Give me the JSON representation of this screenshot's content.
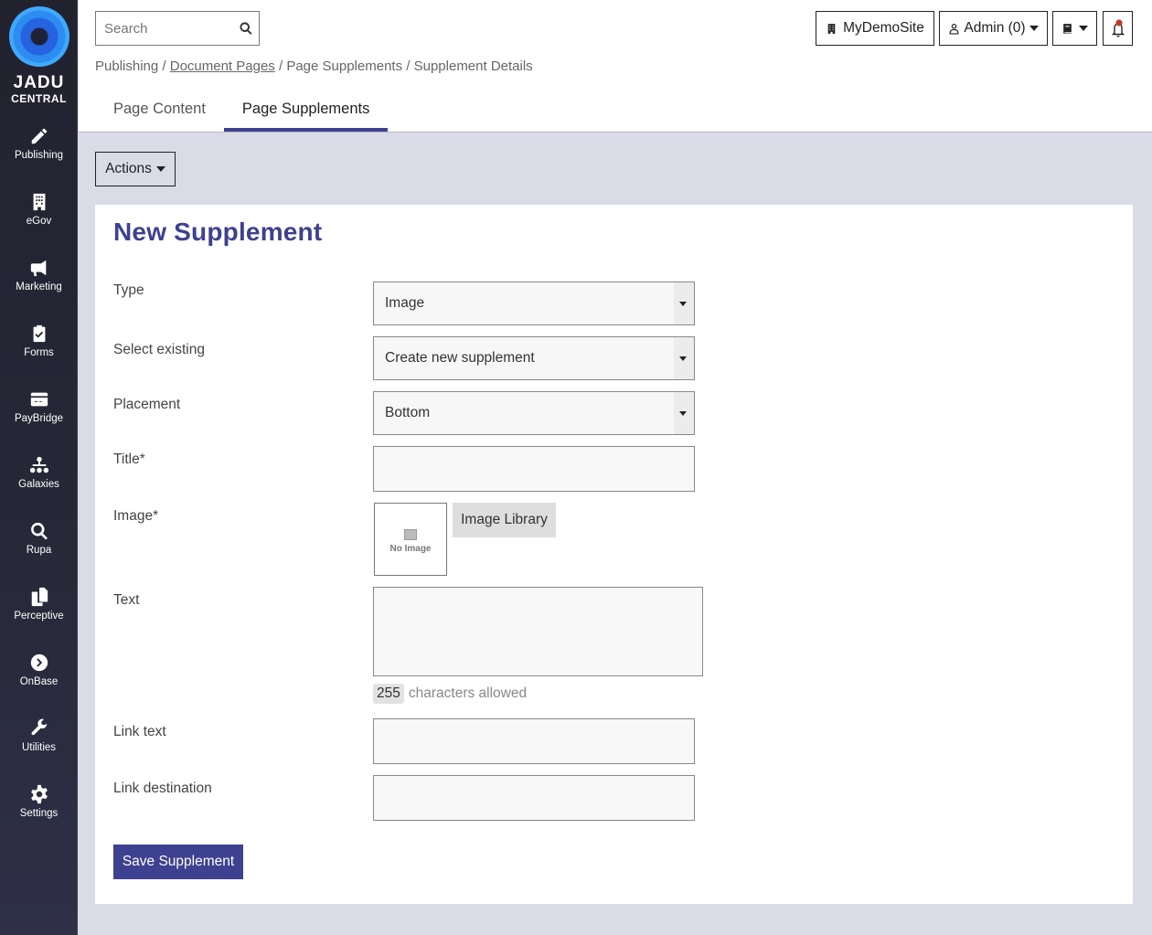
{
  "brand": {
    "line1": "JADU",
    "line2": "CENTRAL",
    "accent": "#3e418f"
  },
  "sidebar": {
    "items": [
      {
        "label": "Publishing",
        "icon": "pencil-icon"
      },
      {
        "label": "eGov",
        "icon": "building-icon"
      },
      {
        "label": "Marketing",
        "icon": "megaphone-icon"
      },
      {
        "label": "Forms",
        "icon": "clipboard-check-icon"
      },
      {
        "label": "PayBridge",
        "icon": "credit-card-icon"
      },
      {
        "label": "Galaxies",
        "icon": "sitemap-icon"
      },
      {
        "label": "Rupa",
        "icon": "search-icon"
      },
      {
        "label": "Perceptive",
        "icon": "copy-icon"
      },
      {
        "label": "OnBase",
        "icon": "chevron-circle-right-icon"
      },
      {
        "label": "Utilities",
        "icon": "wrench-icon"
      },
      {
        "label": "Settings",
        "icon": "gear-icon"
      }
    ]
  },
  "header": {
    "search_placeholder": "Search",
    "site_label": "MyDemoSite",
    "user_label": "Admin (0)",
    "breadcrumb": {
      "root": "Publishing",
      "link": "Document Pages",
      "mid": "Page Supplements",
      "current": "Supplement Details",
      "sep": "/"
    },
    "tabs": [
      {
        "label": "Page Content",
        "active": false
      },
      {
        "label": "Page Supplements",
        "active": true
      }
    ]
  },
  "toolbar": {
    "actions_label": "Actions"
  },
  "form": {
    "title": "New Supplement",
    "type_label": "Type",
    "type_value": "Image",
    "existing_label": "Select existing",
    "existing_value": "Create new supplement",
    "placement_label": "Placement",
    "placement_value": "Bottom",
    "title_label": "Title*",
    "image_label": "Image*",
    "no_image": "No Image",
    "image_library": "Image Library",
    "text_label": "Text",
    "chars_allowed_count": "255",
    "chars_allowed_text": "characters allowed",
    "link_text_label": "Link text",
    "link_dest_label": "Link destination",
    "save_label": "Save Supplement"
  }
}
